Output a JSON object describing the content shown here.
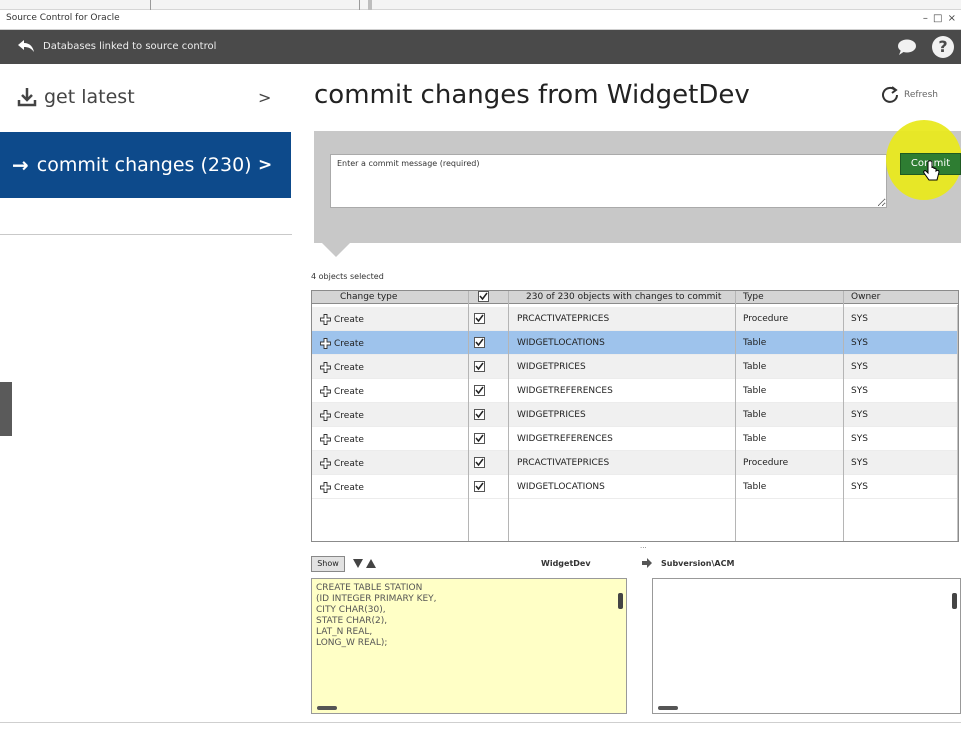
{
  "window": {
    "title": "Source Control for Oracle",
    "controls": "– □ ×"
  },
  "header": {
    "back_label": "Databases linked to source control",
    "help_label": "?"
  },
  "nav": {
    "get_latest": {
      "label": "get latest",
      "chevron": ">"
    },
    "commit_changes": {
      "arrow": "→",
      "label": "commit changes (230)",
      "chevron": ">"
    }
  },
  "main": {
    "title": "commit changes from WidgetDev",
    "refresh_label": "Refresh",
    "commit_placeholder": "Enter a commit message (required)",
    "commit_button": "Commit",
    "objects_selected": "4 objects selected"
  },
  "table": {
    "headers": {
      "change_type": "Change type",
      "name": "230 of 230 objects with changes to commit",
      "type": "Type",
      "owner": "Owner"
    },
    "rows": [
      {
        "change": "Create",
        "name": "PRCACTIVATEPRICES",
        "type": "Procedure",
        "owner": "SYS",
        "checked": true
      },
      {
        "change": "Create",
        "name": "WIDGETLOCATIONS",
        "type": "Table",
        "owner": "SYS",
        "checked": true,
        "selected": true
      },
      {
        "change": "Create",
        "name": "WIDGETPRICES",
        "type": "Table",
        "owner": "SYS",
        "checked": true
      },
      {
        "change": "Create",
        "name": "WIDGETREFERENCES",
        "type": "Table",
        "owner": "SYS",
        "checked": true
      },
      {
        "change": "Create",
        "name": "WIDGETPRICES",
        "type": "Table",
        "owner": "SYS",
        "checked": true
      },
      {
        "change": "Create",
        "name": "WIDGETREFERENCES",
        "type": "Table",
        "owner": "SYS",
        "checked": true
      },
      {
        "change": "Create",
        "name": "PRCACTIVATEPRICES",
        "type": "Procedure",
        "owner": "SYS",
        "checked": true
      },
      {
        "change": "Create",
        "name": "WIDGETLOCATIONS",
        "type": "Table",
        "owner": "SYS",
        "checked": true
      }
    ]
  },
  "diff": {
    "show_label": "Show",
    "left_db": "WidgetDev",
    "right_db": "Subversion\\ACM",
    "splitter": "···",
    "left_code": "CREATE TABLE STATION\n(ID INTEGER PRIMARY KEY,\nCITY CHAR(30),\nSTATE CHAR(2),\nLAT_N REAL,\nLONG_W REAL);",
    "right_code": ""
  },
  "colors": {
    "header_bg": "#4a4a4a",
    "nav_selected": "#0d4a8b",
    "commit_button": "#2e7d32",
    "row_selected": "#9ec3ec",
    "code_bg": "#ffffc6",
    "highlight": "#e9e91f"
  }
}
